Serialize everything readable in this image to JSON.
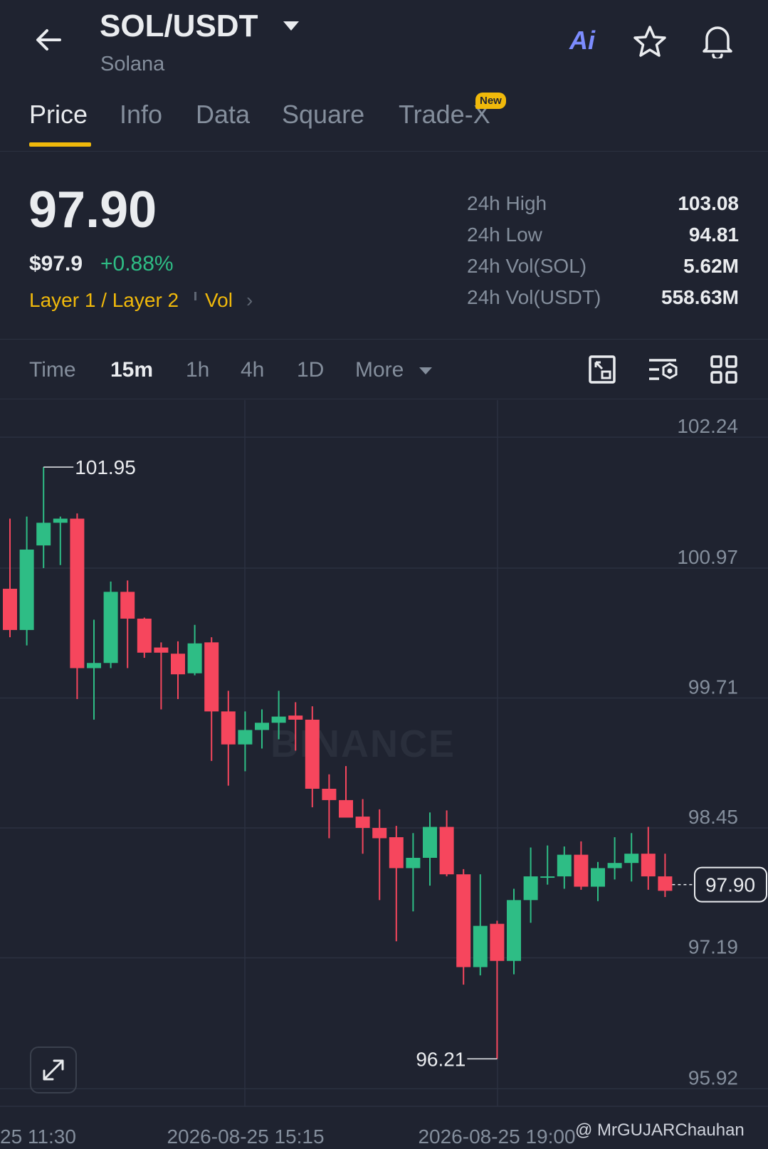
{
  "header": {
    "pair": "SOL/USDT",
    "subtitle": "Solana",
    "ai_label": "Ai"
  },
  "tabs": [
    {
      "label": "Price",
      "active": true
    },
    {
      "label": "Info"
    },
    {
      "label": "Data"
    },
    {
      "label": "Square"
    },
    {
      "label": "Trade-X",
      "badge": "New"
    }
  ],
  "price": {
    "last": "97.90",
    "usd": "$97.9",
    "change": "+0.88%",
    "sector": "Layer 1 / Layer 2",
    "vol_link": "Vol"
  },
  "stats": [
    {
      "label": "24h High",
      "value": "103.08"
    },
    {
      "label": "24h Low",
      "value": "94.81"
    },
    {
      "label": "24h Vol(SOL)",
      "value": "5.62M"
    },
    {
      "label": "24h Vol(USDT)",
      "value": "558.63M"
    }
  ],
  "timeframes": {
    "items": [
      "Time",
      "15m",
      "1h",
      "4h",
      "1D",
      "More"
    ],
    "active": "15m"
  },
  "colors": {
    "bg": "#1f2330",
    "up": "#2ebd85",
    "down": "#f6465d",
    "accent": "#f0b90b"
  },
  "chart_data": {
    "type": "candlestick",
    "y_ticks": [
      102.24,
      100.97,
      99.71,
      98.45,
      97.19,
      95.92
    ],
    "ylim": [
      95.75,
      102.6
    ],
    "x_ticks": [
      "25 11:30",
      "2026-08-25 15:15",
      "2026-08-25 19:00"
    ],
    "last_price_label": "97.90",
    "last_price": 97.9,
    "high_marker": {
      "value": 101.95,
      "label": "101.95"
    },
    "low_marker": {
      "value": 96.21,
      "label": "96.21"
    },
    "watermark": "BINANCE",
    "candles": [
      {
        "o": 100.77,
        "h": 101.45,
        "l": 100.3,
        "c": 100.37
      },
      {
        "o": 100.37,
        "h": 101.47,
        "l": 100.22,
        "c": 101.15
      },
      {
        "o": 101.19,
        "h": 101.95,
        "l": 100.97,
        "c": 101.41
      },
      {
        "o": 101.41,
        "h": 101.47,
        "l": 101.0,
        "c": 101.45
      },
      {
        "o": 101.45,
        "h": 101.5,
        "l": 99.7,
        "c": 100.0
      },
      {
        "o": 100.0,
        "h": 100.47,
        "l": 99.5,
        "c": 100.05
      },
      {
        "o": 100.05,
        "h": 100.84,
        "l": 100.0,
        "c": 100.74
      },
      {
        "o": 100.74,
        "h": 100.85,
        "l": 100.0,
        "c": 100.48
      },
      {
        "o": 100.48,
        "h": 100.49,
        "l": 100.1,
        "c": 100.15
      },
      {
        "o": 100.2,
        "h": 100.25,
        "l": 99.6,
        "c": 100.15
      },
      {
        "o": 100.14,
        "h": 100.26,
        "l": 99.7,
        "c": 99.94
      },
      {
        "o": 99.95,
        "h": 100.42,
        "l": 99.93,
        "c": 100.24
      },
      {
        "o": 100.25,
        "h": 100.3,
        "l": 99.1,
        "c": 99.58
      },
      {
        "o": 99.58,
        "h": 99.78,
        "l": 98.86,
        "c": 99.26
      },
      {
        "o": 99.26,
        "h": 99.58,
        "l": 99.0,
        "c": 99.4
      },
      {
        "o": 99.4,
        "h": 99.6,
        "l": 99.22,
        "c": 99.47
      },
      {
        "o": 99.47,
        "h": 99.78,
        "l": 99.31,
        "c": 99.53
      },
      {
        "o": 99.54,
        "h": 99.67,
        "l": 99.2,
        "c": 99.5
      },
      {
        "o": 99.5,
        "h": 99.63,
        "l": 98.65,
        "c": 98.83
      },
      {
        "o": 98.83,
        "h": 98.97,
        "l": 98.35,
        "c": 98.72
      },
      {
        "o": 98.72,
        "h": 99.05,
        "l": 98.6,
        "c": 98.55
      },
      {
        "o": 98.56,
        "h": 98.73,
        "l": 98.2,
        "c": 98.45
      },
      {
        "o": 98.45,
        "h": 98.63,
        "l": 97.75,
        "c": 98.35
      },
      {
        "o": 98.36,
        "h": 98.47,
        "l": 97.35,
        "c": 98.06
      },
      {
        "o": 98.06,
        "h": 98.4,
        "l": 97.64,
        "c": 98.16
      },
      {
        "o": 98.16,
        "h": 98.6,
        "l": 97.89,
        "c": 98.46
      },
      {
        "o": 98.46,
        "h": 98.62,
        "l": 97.98,
        "c": 98.0
      },
      {
        "o": 98.0,
        "h": 98.05,
        "l": 96.93,
        "c": 97.1
      },
      {
        "o": 97.1,
        "h": 98.0,
        "l": 97.02,
        "c": 97.5
      },
      {
        "o": 97.52,
        "h": 97.55,
        "l": 96.21,
        "c": 97.16
      },
      {
        "o": 97.16,
        "h": 97.86,
        "l": 97.03,
        "c": 97.75
      },
      {
        "o": 97.75,
        "h": 98.26,
        "l": 97.53,
        "c": 97.98
      },
      {
        "o": 97.98,
        "h": 98.28,
        "l": 97.9,
        "c": 97.98
      },
      {
        "o": 97.98,
        "h": 98.27,
        "l": 97.86,
        "c": 98.19
      },
      {
        "o": 98.19,
        "h": 98.32,
        "l": 97.85,
        "c": 97.88
      },
      {
        "o": 97.88,
        "h": 98.12,
        "l": 97.74,
        "c": 98.06
      },
      {
        "o": 98.06,
        "h": 98.36,
        "l": 97.95,
        "c": 98.11
      },
      {
        "o": 98.11,
        "h": 98.4,
        "l": 97.93,
        "c": 98.2
      },
      {
        "o": 98.2,
        "h": 98.46,
        "l": 97.85,
        "c": 97.98
      },
      {
        "o": 97.98,
        "h": 98.2,
        "l": 97.78,
        "c": 97.84
      }
    ]
  },
  "footer": {
    "credit": "@ MrGUJARChauhan"
  }
}
